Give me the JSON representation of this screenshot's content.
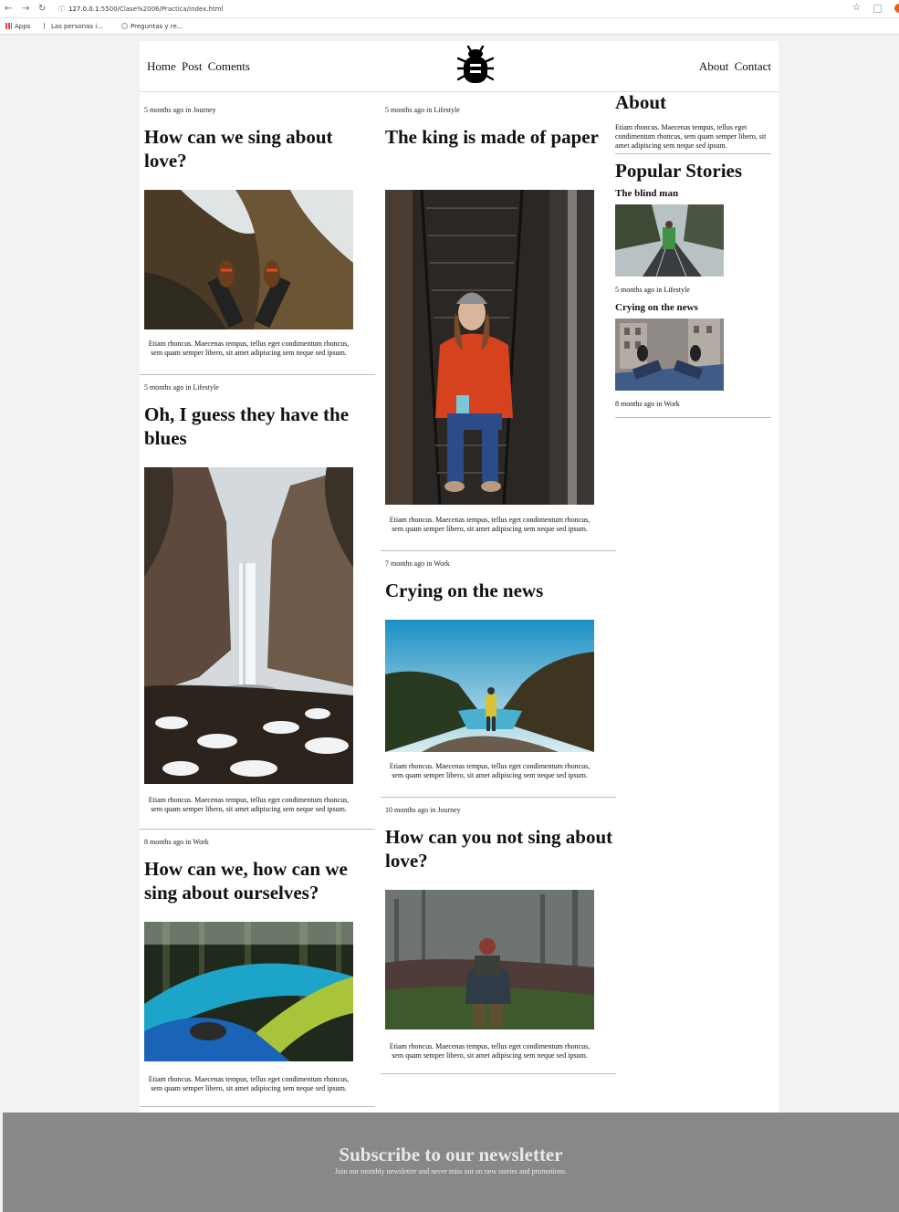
{
  "browser": {
    "url_host": "127.0.0.1",
    "url_path": ":5500/Clase%2006/Practica/index.html",
    "bookmarks": [
      "Apps",
      "Las personas i...",
      "Preguntas y re..."
    ]
  },
  "nav": {
    "left": [
      "Home",
      "Post",
      "Coments"
    ],
    "right": [
      "About",
      "Contact"
    ]
  },
  "posts": [
    {
      "ago": "5 months ago in",
      "cat": "Journey",
      "title": "How can we sing about love?",
      "excerpt": "Etiam rhoncus. Maecenas tempus, tellus eget condimentum rhoncus, sem quam semper libero, sit amet adipiscing sem neque sed ipsum.",
      "image": "boots-on-waterfall-ledge"
    },
    {
      "ago": "5 months ago in",
      "cat": "Lifestyle",
      "title": "Oh, I guess they have the blues",
      "excerpt": "Etiam rhoncus. Maecenas tempus, tellus eget condimentum rhoncus, sem quam semper libero, sit amet adipiscing sem neque sed ipsum.",
      "image": "snowy-waterfall-canyon"
    },
    {
      "ago": "8 months ago in",
      "cat": "Work",
      "title": "How can we, how can we sing about ourselves?",
      "excerpt": "Etiam rhoncus. Maecenas tempus, tellus eget condimentum rhoncus, sem quam semper libero, sit amet adipiscing sem neque sed ipsum.",
      "image": "hammocks-in-forest"
    },
    {
      "ago": "5 months ago in",
      "cat": "Lifestyle",
      "title": "The king is made of paper",
      "excerpt": "Etiam rhoncus. Maecenas tempus, tellus eget condimentum rhoncus, sem quam semper libero, sit amet adipiscing sem neque sed ipsum.",
      "image": "woman-on-fire-escape"
    },
    {
      "ago": "7 months ago in",
      "cat": "Work",
      "title": "Crying on the news",
      "excerpt": "Etiam rhoncus. Maecenas tempus, tellus eget condimentum rhoncus, sem quam semper libero, sit amet adipiscing sem neque sed ipsum.",
      "image": "hiker-over-mountain-lake"
    },
    {
      "ago": "10 months ago in",
      "cat": "Journey",
      "title": "How can you not sing about love?",
      "excerpt": "Etiam rhoncus. Maecenas tempus, tellus eget condimentum rhoncus, sem quam semper libero, sit amet adipiscing sem neque sed ipsum.",
      "image": "hiker-in-misty-field"
    }
  ],
  "sidebar": {
    "about_title": "About",
    "about_text": "Etiam rhoncus. Maecenas tempus, tellus eget condimentum rhoncus, sem quam semper libero, sit amet adipiscing sem neque sed ipsum.",
    "popular_title": "Popular Stories",
    "stories": [
      {
        "title": "The blind man",
        "ago": "5 months ago in",
        "cat": "Lifestyle",
        "image": "man-on-railway-bridge"
      },
      {
        "title": "Crying on the news",
        "ago": "8 months ago in",
        "cat": "Work",
        "image": "feet-over-city-rooftop"
      }
    ]
  },
  "footer": {
    "title": "Subscribe to our newsletter",
    "text": "Join our monthly newsletter and never miss out on new stories and promotions."
  },
  "colors": {
    "footer_bg": "#888888",
    "page_bg": "#f2f2f2",
    "card_bg": "#ffffff"
  }
}
